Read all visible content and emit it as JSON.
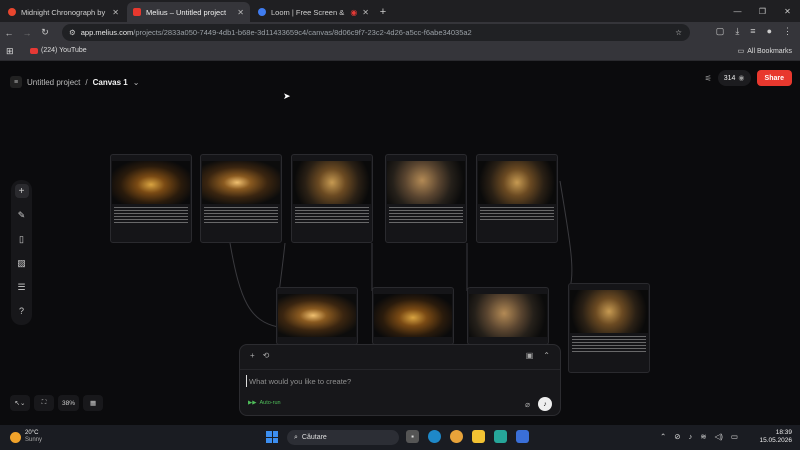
{
  "browser": {
    "tabs": [
      {
        "title": "Midnight Chronograph by abst",
        "favicon_color": "#e8462e",
        "active": false
      },
      {
        "title": "Melius – Untitled project",
        "favicon_color": "#e8382e",
        "active": true
      },
      {
        "title": "Loom | Free Screen & Video",
        "favicon_color": "#3f7cf0",
        "active": false
      }
    ],
    "new_tab_symbol": "+",
    "url_host": "app.melius.com",
    "url_path": "/projects/2833a050-7449-4db1-b68e-3d11433659c4/canvas/8d06c9f7-23c2-4d26-a5cc-f6abe34035a2",
    "bookmarks": [
      {
        "label": "(224) YouTube"
      }
    ],
    "all_bookmarks_label": "All Bookmarks"
  },
  "app": {
    "project_name": "Untitled project",
    "separator": "/",
    "canvas_name": "Canvas 1",
    "credits": "314",
    "share_label": "Share",
    "zoom": "38%",
    "prompt": {
      "placeholder": "What would you like to create?",
      "autorun_label": "Auto-run"
    }
  },
  "taskbar": {
    "temperature": "20°C",
    "weather": "Sunny",
    "search_label": "Căutare",
    "time": "18:39",
    "date": "15.05.2026"
  },
  "colors": {
    "accent": "#e8382e",
    "autorun": "#4fbf5a",
    "background": "#0b0b0d"
  }
}
